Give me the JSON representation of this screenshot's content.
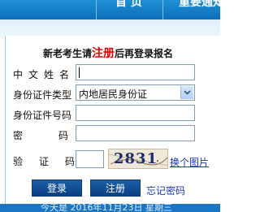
{
  "nav": {
    "item_a": "首 页",
    "item_b": "重要通知"
  },
  "notice": {
    "prefix": "新老考生请",
    "highlight": "注册",
    "suffix": "后再登录报名"
  },
  "form": {
    "name_label": "中文姓名",
    "idtype_label": "身份证件类型",
    "idtype_value": "内地居民身份证",
    "idno_label": "身份证件号码",
    "password_label": "密码",
    "captcha_label": "验证码",
    "captcha_text": "2831",
    "change_captcha": "换个图片"
  },
  "buttons": {
    "login": "登录",
    "register": "注册",
    "forgot": "忘记密码"
  },
  "footer": {
    "date_text": "今天是 2016年11月23日 星期三"
  },
  "colors": {
    "accent": "#0d3f80",
    "highlight": "#e00000",
    "link": "#1a35b8"
  },
  "icons": {
    "select_arrow": "chevron-down-icon"
  }
}
